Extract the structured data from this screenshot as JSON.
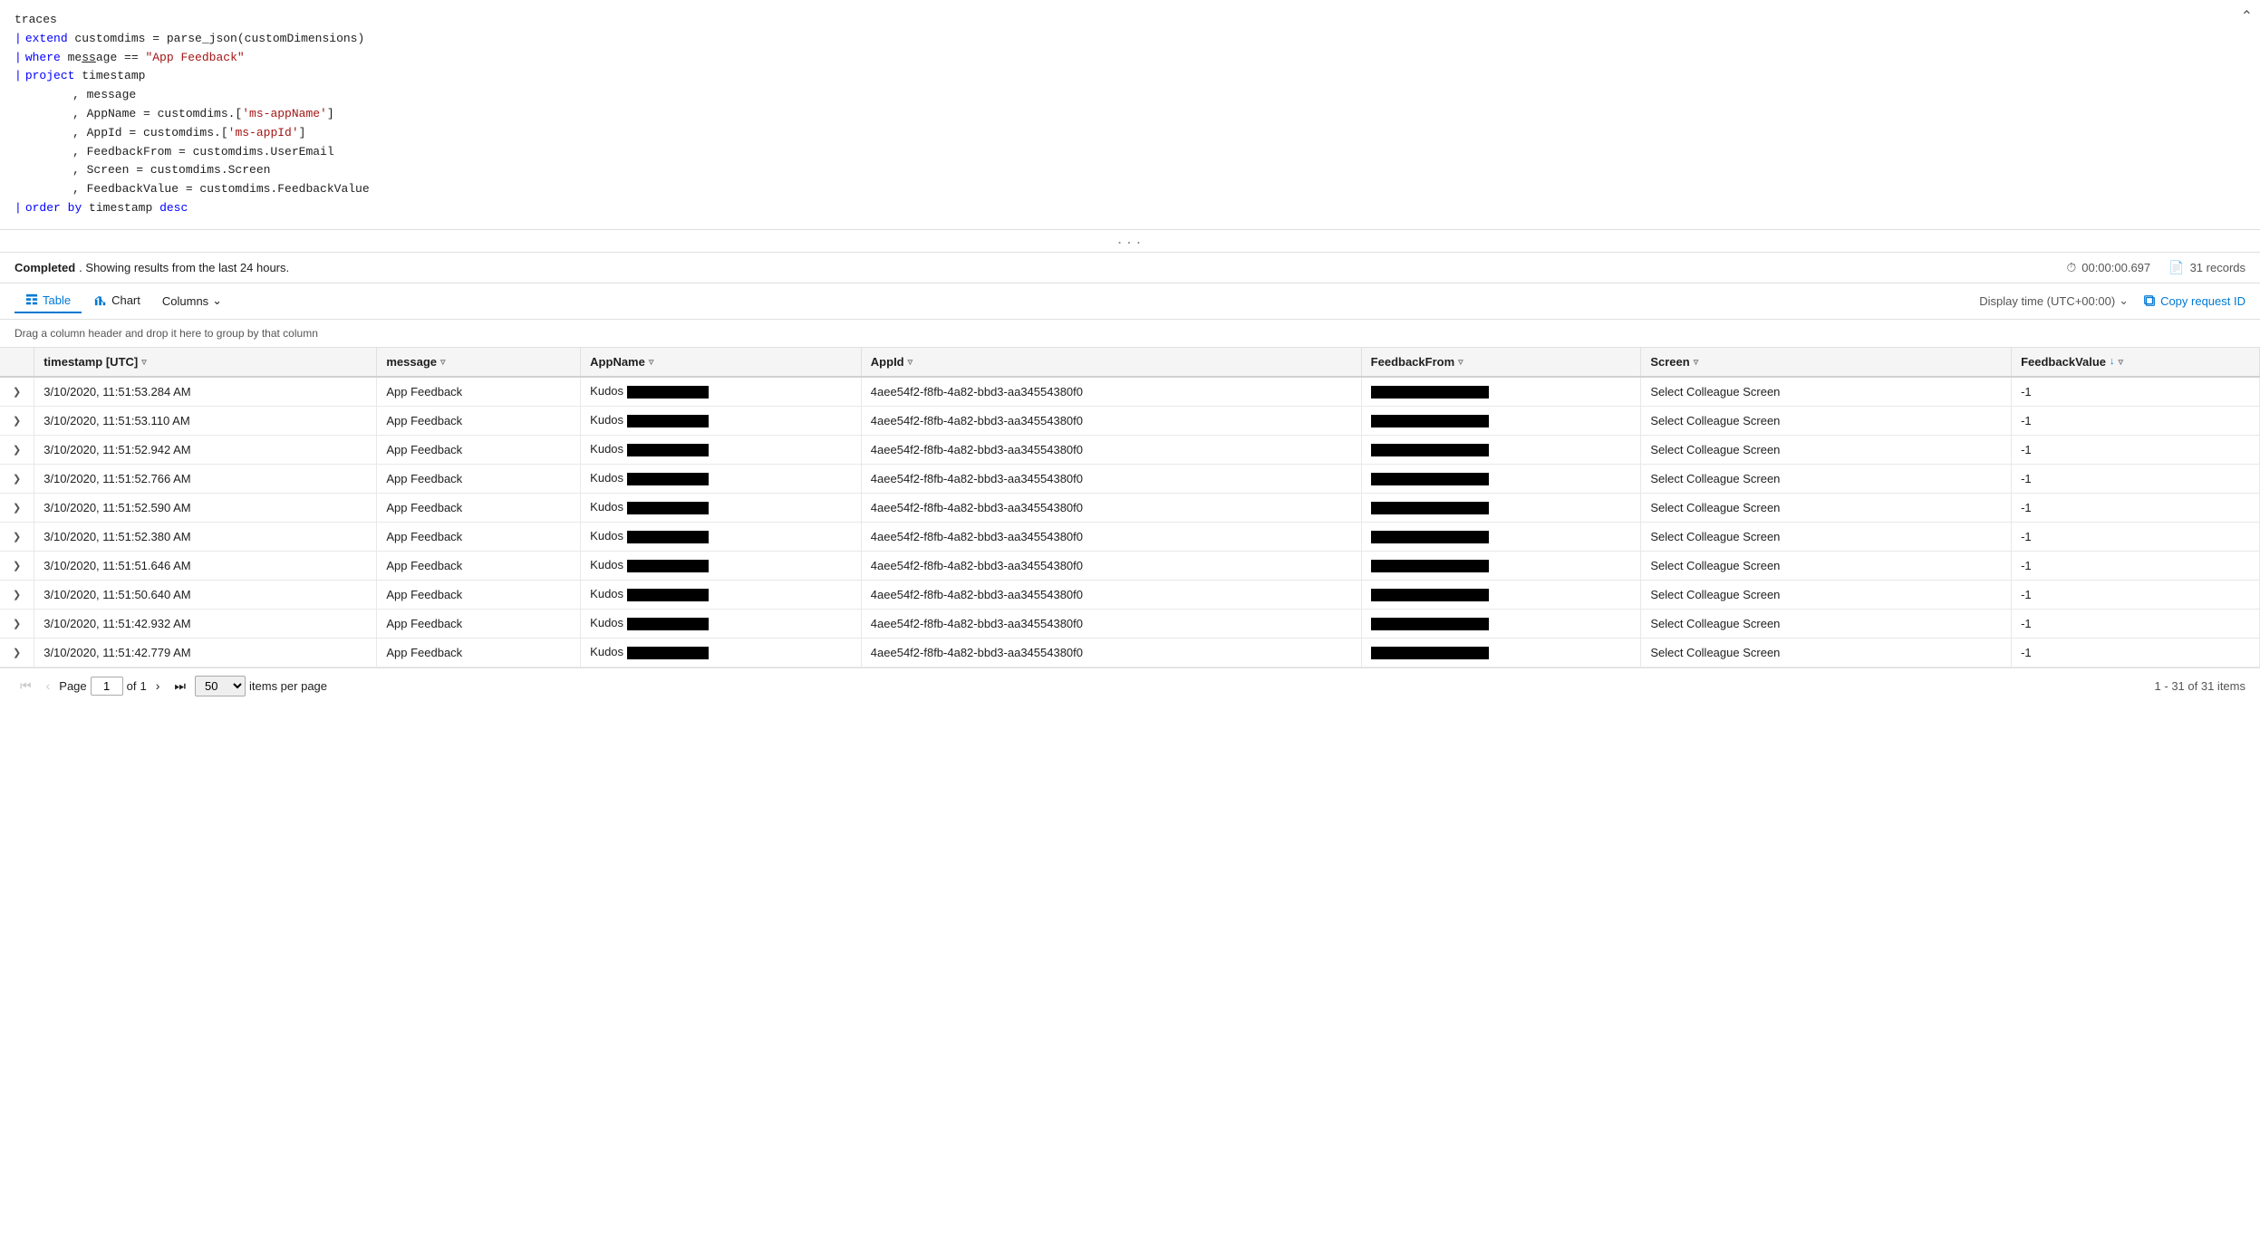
{
  "editor": {
    "lines": [
      {
        "indent": 0,
        "pipe": false,
        "content": [
          {
            "type": "normal",
            "text": "traces"
          }
        ]
      },
      {
        "indent": 0,
        "pipe": true,
        "content": [
          {
            "type": "blue",
            "text": "extend"
          },
          {
            "type": "normal",
            "text": " customdims = parse_json(customDimensions)"
          }
        ]
      },
      {
        "indent": 0,
        "pipe": true,
        "content": [
          {
            "type": "blue",
            "text": "where"
          },
          {
            "type": "normal",
            "text": " message == "
          },
          {
            "type": "red",
            "text": "\"App Feedback\""
          }
        ]
      },
      {
        "indent": 0,
        "pipe": true,
        "content": [
          {
            "type": "blue",
            "text": "project"
          },
          {
            "type": "normal",
            "text": " timestamp"
          }
        ]
      },
      {
        "indent": 2,
        "pipe": false,
        "content": [
          {
            "type": "normal",
            "text": ", message"
          }
        ]
      },
      {
        "indent": 2,
        "pipe": false,
        "content": [
          {
            "type": "normal",
            "text": ", AppName = customdims.["
          },
          {
            "type": "red",
            "text": "'ms-appName'"
          },
          {
            "type": "normal",
            "text": "]"
          }
        ]
      },
      {
        "indent": 2,
        "pipe": false,
        "content": [
          {
            "type": "normal",
            "text": ", AppId = customdims.["
          },
          {
            "type": "red",
            "text": "'ms-appId'"
          },
          {
            "type": "normal",
            "text": "]"
          }
        ]
      },
      {
        "indent": 2,
        "pipe": false,
        "content": [
          {
            "type": "normal",
            "text": ", FeedbackFrom = customdims.UserEmail"
          }
        ]
      },
      {
        "indent": 2,
        "pipe": false,
        "content": [
          {
            "type": "normal",
            "text": ", Screen = customdims.Screen"
          }
        ]
      },
      {
        "indent": 2,
        "pipe": false,
        "content": [
          {
            "type": "normal",
            "text": ", FeedbackValue = customdims.FeedbackValue"
          }
        ]
      },
      {
        "indent": 0,
        "pipe": true,
        "content": [
          {
            "type": "blue",
            "text": "order"
          },
          {
            "type": "normal",
            "text": " "
          },
          {
            "type": "blue",
            "text": "by"
          },
          {
            "type": "normal",
            "text": " timestamp "
          },
          {
            "type": "blue",
            "text": "desc"
          }
        ]
      }
    ]
  },
  "status": {
    "completed_text": "Completed",
    "showing_text": ". Showing results from the last 24 hours.",
    "time": "00:00:00.697",
    "records": "31 records"
  },
  "toolbar": {
    "tab_table": "Table",
    "tab_chart": "Chart",
    "columns_label": "Columns",
    "display_time": "Display time (UTC+00:00)",
    "copy_request": "Copy request ID"
  },
  "drag_hint": "Drag a column header and drop it here to group by that column",
  "table": {
    "columns": [
      {
        "id": "expand",
        "label": ""
      },
      {
        "id": "timestamp",
        "label": "timestamp [UTC]"
      },
      {
        "id": "message",
        "label": "message"
      },
      {
        "id": "appname",
        "label": "AppName"
      },
      {
        "id": "appid",
        "label": "AppId"
      },
      {
        "id": "feedbackfrom",
        "label": "FeedbackFrom"
      },
      {
        "id": "screen",
        "label": "Screen"
      },
      {
        "id": "feedbackvalue",
        "label": "FeedbackValue"
      }
    ],
    "rows": [
      {
        "ts": "3/10/2020, 11:51:53.284 AM",
        "msg": "App Feedback",
        "app": "Kudos",
        "appid": "4aee54f2-f8fb-4a82-bbd3-aa34554380f0",
        "screen": "Select Colleague Screen",
        "fbval": "-1"
      },
      {
        "ts": "3/10/2020, 11:51:53.110 AM",
        "msg": "App Feedback",
        "app": "Kudos",
        "appid": "4aee54f2-f8fb-4a82-bbd3-aa34554380f0",
        "screen": "Select Colleague Screen",
        "fbval": "-1"
      },
      {
        "ts": "3/10/2020, 11:51:52.942 AM",
        "msg": "App Feedback",
        "app": "Kudos",
        "appid": "4aee54f2-f8fb-4a82-bbd3-aa34554380f0",
        "screen": "Select Colleague Screen",
        "fbval": "-1"
      },
      {
        "ts": "3/10/2020, 11:51:52.766 AM",
        "msg": "App Feedback",
        "app": "Kudos",
        "appid": "4aee54f2-f8fb-4a82-bbd3-aa34554380f0",
        "screen": "Select Colleague Screen",
        "fbval": "-1"
      },
      {
        "ts": "3/10/2020, 11:51:52.590 AM",
        "msg": "App Feedback",
        "app": "Kudos",
        "appid": "4aee54f2-f8fb-4a82-bbd3-aa34554380f0",
        "screen": "Select Colleague Screen",
        "fbval": "-1"
      },
      {
        "ts": "3/10/2020, 11:51:52.380 AM",
        "msg": "App Feedback",
        "app": "Kudos",
        "appid": "4aee54f2-f8fb-4a82-bbd3-aa34554380f0",
        "screen": "Select Colleague Screen",
        "fbval": "-1"
      },
      {
        "ts": "3/10/2020, 11:51:51.646 AM",
        "msg": "App Feedback",
        "app": "Kudos",
        "appid": "4aee54f2-f8fb-4a82-bbd3-aa34554380f0",
        "screen": "Select Colleague Screen",
        "fbval": "-1"
      },
      {
        "ts": "3/10/2020, 11:51:50.640 AM",
        "msg": "App Feedback",
        "app": "Kudos",
        "appid": "4aee54f2-f8fb-4a82-bbd3-aa34554380f0",
        "screen": "Select Colleague Screen",
        "fbval": "-1"
      },
      {
        "ts": "3/10/2020, 11:51:42.932 AM",
        "msg": "App Feedback",
        "app": "Kudos",
        "appid": "4aee54f2-f8fb-4a82-bbd3-aa34554380f0",
        "screen": "Select Colleague Screen",
        "fbval": "-1"
      },
      {
        "ts": "3/10/2020, 11:51:42.779 AM",
        "msg": "App Feedback",
        "app": "Kudos",
        "appid": "4aee54f2-f8fb-4a82-bbd3-aa34554380f0",
        "screen": "Select Colleague Screen",
        "fbval": "-1"
      }
    ]
  },
  "pagination": {
    "page_label": "Page",
    "current_page": "1",
    "of_label": "of",
    "of_pages": "1",
    "per_page": "50",
    "summary": "1 - 31 of 31 items",
    "items_per_page_label": "items per page"
  }
}
